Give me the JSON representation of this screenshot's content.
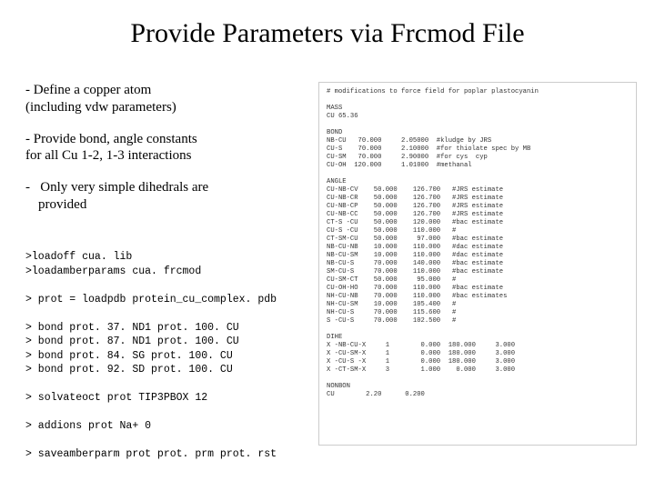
{
  "title": "Provide Parameters via Frcmod File",
  "bullets": {
    "b1_line1": "- Define a copper atom",
    "b1_line2": "(including vdw parameters)",
    "b2_line1": "- Provide bond, angle constants",
    "b2_line2": "for all Cu 1-2, 1-3 interactions",
    "b3_line1": "-   Only very simple dihedrals are",
    "b3_line2": "provided"
  },
  "code": ">loadoff cua. lib\n>loadamberparams cua. frcmod\n\n> prot = loadpdb protein_cu_complex. pdb\n\n> bond prot. 37. ND1 prot. 100. CU\n> bond prot. 87. ND1 prot. 100. CU\n> bond prot. 84. SG prot. 100. CU\n> bond prot. 92. SD prot. 100. CU\n\n> solvateoct prot TIP3PBOX 12\n\n> addions prot Na+ 0\n\n> saveamberparm prot prot. prm prot. rst",
  "frcmod": "# modifications to force field for poplar plastocyanin\n\nMASS\nCU 65.36\n\nBOND\nNB-CU   70.000     2.05000  #kludge by JRS\nCU-S    70.000     2.10000  #for thiolate spec by MB\nCU-SM   70.000     2.90000  #for cys  cyp\nCU-OH  120.000     1.01000  #methanal\n\nANGLE\nCU-NB-CV    50.000    126.700   #JRS estimate\nCU-NB-CR    50.000    126.700   #JRS estimate\nCU-NB-CP    50.000    126.700   #JRS estimate\nCU-NB-CC    50.000    126.700   #JRS estimate\nCT-S -CU    50.000    120.000   #bac estimate\nCU-S -CU    50.000    110.000   #\nCT-SM-CU    50.000     97.000   #bac estimate\nNB-CU-NB    10.000    110.000   #dac estimate\nNB-CU-SM    10.000    110.000   #dac estimate\nNB-CU-S     70.000    140.000   #bac estimate\nSM-CU-S     70.000    110.000   #bac estimate\nCU-SM-CT    50.000     95.000   #\nCU-OH-HO    70.000    110.000   #bac estimate\nNH-CU-NB    70.000    110.000   #bac estimates\nNH-CU-SM    10.000    105.400   #\nNH-CU-S     70.000    115.600   #\nS -CU-S     70.000    102.500   #\n\nDIHE\nX -NB-CU-X     1        0.000  180.000     3.000\nX -CU-SM-X     1        0.000  180.000     3.000\nX -CU-S -X     1        0.000  180.000     3.000\nX -CT-SM-X     3        1.000    0.000     3.000\n\nNONBON\nCU        2.20      0.200"
}
